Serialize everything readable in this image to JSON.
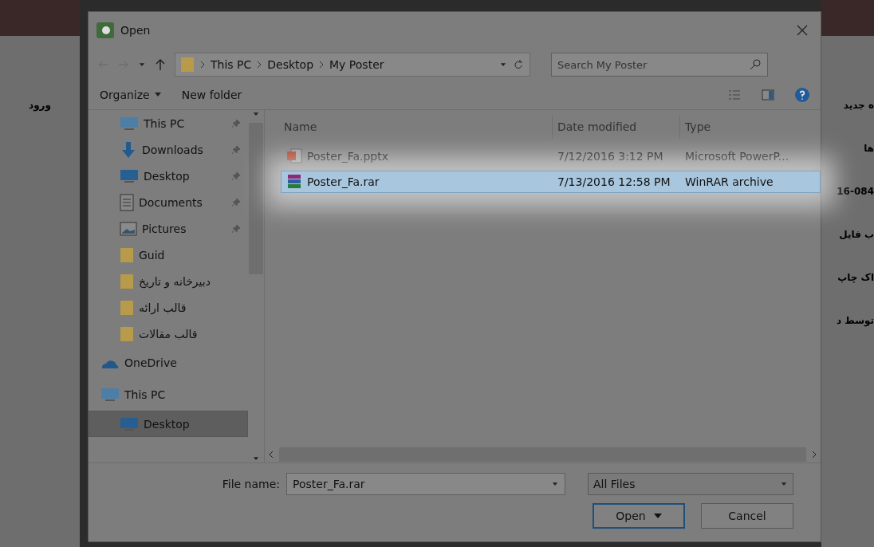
{
  "background_page": {
    "left_texts": [
      "ورود"
    ],
    "right_texts": [
      "ه جدید",
      "ها",
      "16-084",
      "ب فایل",
      "اک چاپ",
      "توسط د"
    ]
  },
  "window": {
    "title": "Open"
  },
  "address_bar": {
    "path": [
      "This PC",
      "Desktop",
      "My Poster"
    ],
    "search_placeholder": "Search My Poster"
  },
  "toolbar": {
    "organize": "Organize",
    "new_folder": "New folder"
  },
  "sidebar": {
    "items": [
      {
        "label": "This PC",
        "kind": "pc",
        "pinned": true,
        "selected": false
      },
      {
        "label": "Downloads",
        "kind": "downloads",
        "pinned": true,
        "selected": false
      },
      {
        "label": "Desktop",
        "kind": "desktop",
        "pinned": true,
        "selected": false
      },
      {
        "label": "Documents",
        "kind": "documents",
        "pinned": true,
        "selected": false
      },
      {
        "label": "Pictures",
        "kind": "pictures",
        "pinned": true,
        "selected": false
      },
      {
        "label": "Guid",
        "kind": "folder",
        "pinned": false,
        "selected": false
      },
      {
        "label": "دبیرخانه و تاریخ",
        "kind": "folder",
        "pinned": false,
        "selected": false
      },
      {
        "label": "قالب ارائه",
        "kind": "folder",
        "pinned": false,
        "selected": false
      },
      {
        "label": "قالب مقالات",
        "kind": "folder",
        "pinned": false,
        "selected": false
      },
      {
        "label": "OneDrive",
        "kind": "cloud",
        "pinned": false,
        "selected": false,
        "root": true
      },
      {
        "label": "This PC",
        "kind": "pc",
        "pinned": false,
        "selected": false,
        "root": true
      },
      {
        "label": "Desktop",
        "kind": "desktop",
        "pinned": false,
        "selected": true
      }
    ]
  },
  "table": {
    "columns": [
      "Name",
      "Date modified",
      "Type"
    ],
    "rows": [
      {
        "kind": "pptx",
        "name": "Poster_Fa.pptx",
        "date": "7/12/2016 3:12 PM",
        "type": "Microsoft PowerP...",
        "selected": false
      },
      {
        "kind": "rar",
        "name": "Poster_Fa.rar",
        "date": "7/13/2016 12:58 PM",
        "type": "WinRAR archive",
        "selected": true
      }
    ]
  },
  "file_name": {
    "label": "File name:",
    "value": "Poster_Fa.rar"
  },
  "file_type": {
    "value": "All Files"
  },
  "buttons": {
    "open": "Open",
    "cancel": "Cancel"
  }
}
